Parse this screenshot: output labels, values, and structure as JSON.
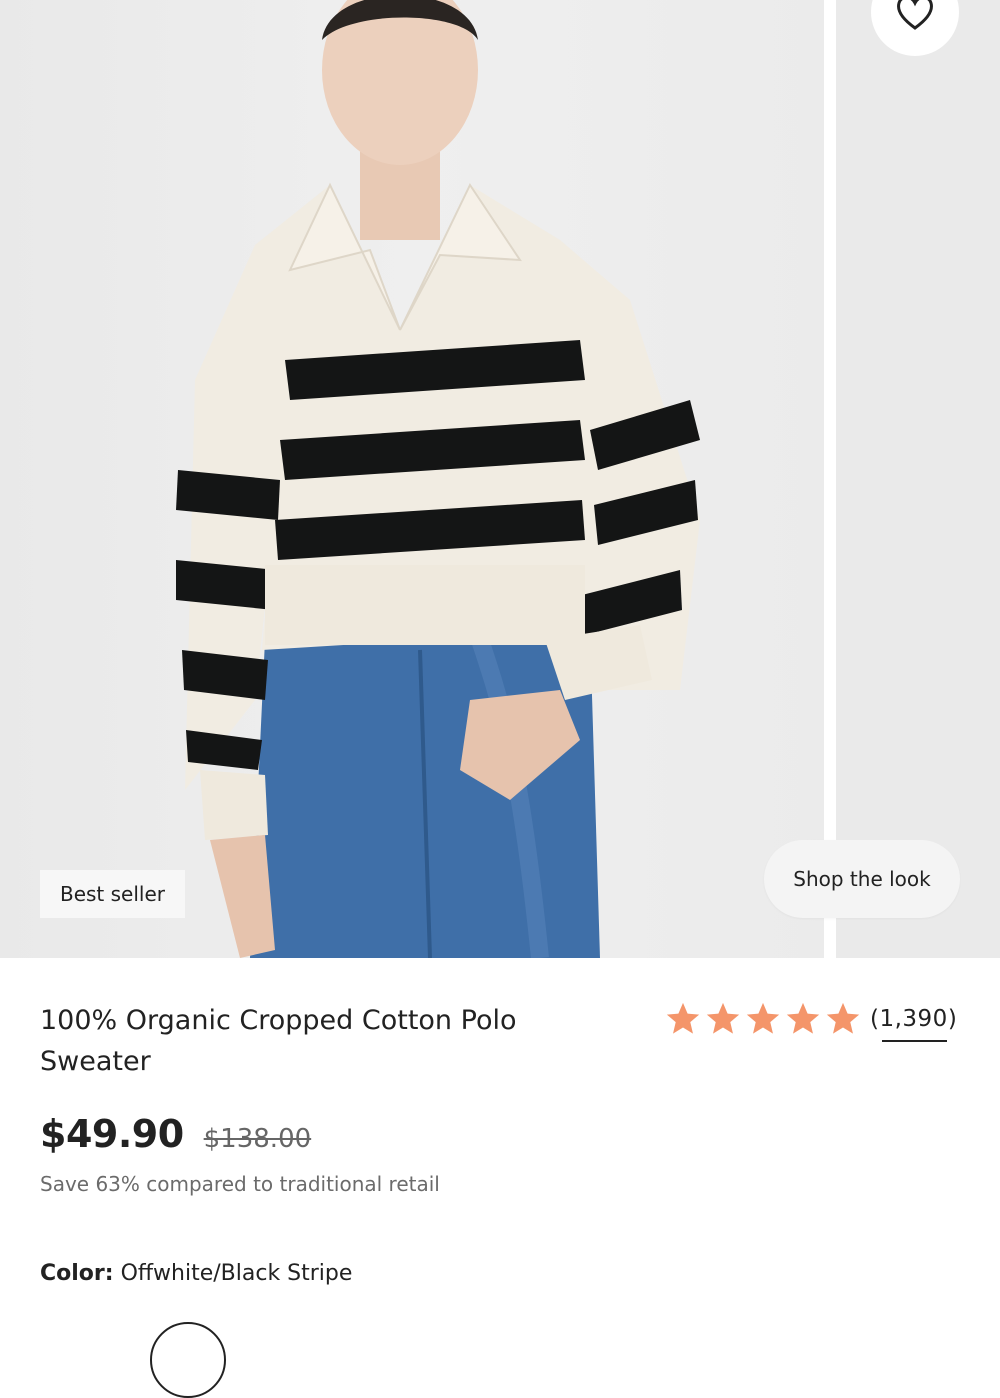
{
  "gallery": {
    "badge_label": "Best seller",
    "shop_look_label": "Shop the look",
    "favorite_icon": "heart-icon"
  },
  "product": {
    "title": "100% Organic Cropped Cotton Polo Sweater",
    "rating": {
      "stars": 5,
      "count_label": "(1,390)",
      "star_color": "#F4956A"
    },
    "price": "$49.90",
    "original_price": "$138.00",
    "savings_text": "Save 63% compared to traditional retail",
    "color_label": "Color:",
    "color_value": "Offwhite/Black Stripe"
  }
}
